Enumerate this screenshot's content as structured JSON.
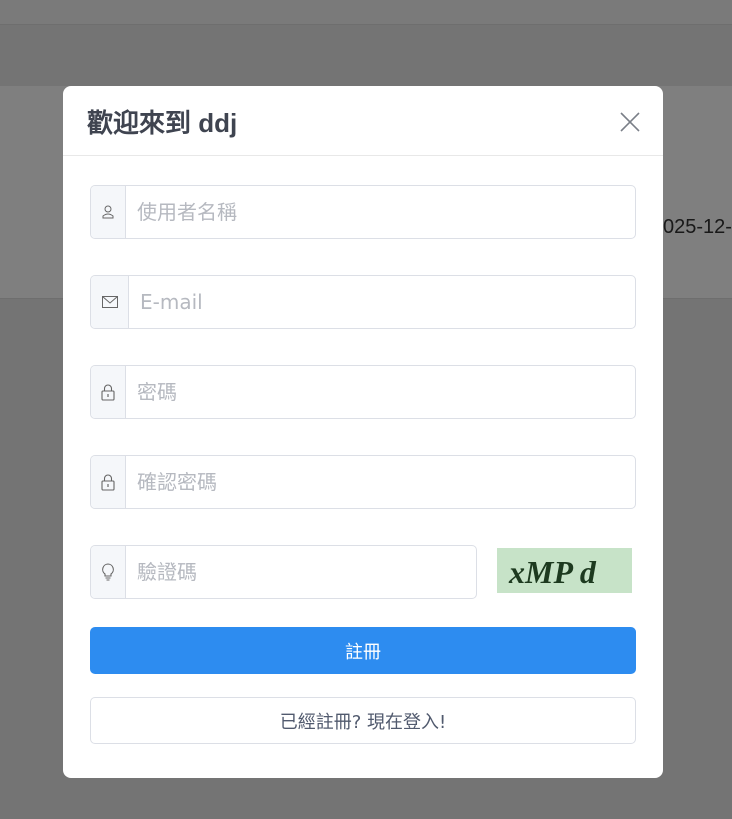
{
  "background": {
    "date_fragment": "025-12-"
  },
  "modal": {
    "title": "歡迎來到 ddj",
    "close_icon": "close-icon"
  },
  "form": {
    "username": {
      "placeholder": "使用者名稱",
      "value": "",
      "icon": "user-icon"
    },
    "email": {
      "placeholder": "E-mail",
      "value": "",
      "icon": "mail-icon"
    },
    "password": {
      "placeholder": "密碼",
      "value": "",
      "icon": "lock-icon"
    },
    "confirm_password": {
      "placeholder": "確認密碼",
      "value": "",
      "icon": "lock-icon"
    },
    "captcha": {
      "placeholder": "驗證碼",
      "value": "",
      "icon": "lightbulb-icon",
      "image_text": "xMP d"
    }
  },
  "buttons": {
    "register_label": "註冊",
    "login_label": "已經註冊? 現在登入!"
  },
  "colors": {
    "primary": "#2d8cf0",
    "captcha_bg": "#c7e3c8",
    "overlay": "rgba(0,0,0,0.5)"
  }
}
